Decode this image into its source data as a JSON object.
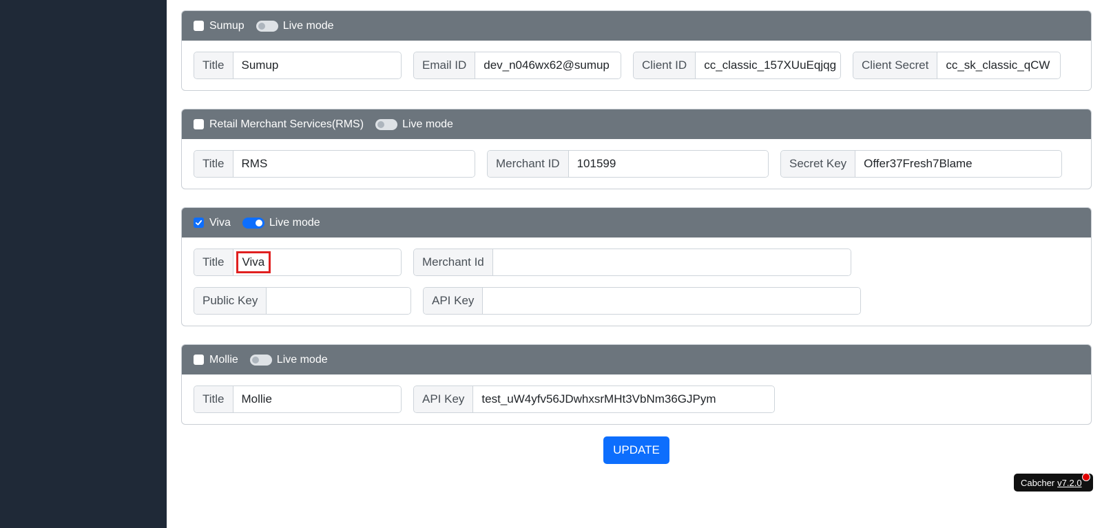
{
  "providers": [
    {
      "name": "Sumup",
      "checked": false,
      "live_mode_on": false,
      "live_mode_label": "Live mode",
      "fields": [
        {
          "label": "Title",
          "value": "Sumup"
        },
        {
          "label": "Email ID",
          "value": "dev_n046wx62@sumup"
        },
        {
          "label": "Client ID",
          "value": "cc_classic_157XUuEqjqg"
        },
        {
          "label": "Client Secret",
          "value": "cc_sk_classic_qCW"
        }
      ]
    },
    {
      "name": "Retail Merchant Services(RMS)",
      "checked": false,
      "live_mode_on": false,
      "live_mode_label": "Live mode",
      "fields": [
        {
          "label": "Title",
          "value": "RMS"
        },
        {
          "label": "Merchant ID",
          "value": "101599"
        },
        {
          "label": "Secret Key",
          "value": "Offer37Fresh7Blame"
        }
      ]
    },
    {
      "name": "Viva",
      "checked": true,
      "live_mode_on": true,
      "live_mode_label": "Live mode",
      "fields": [
        {
          "label": "Title",
          "value": "Viva"
        },
        {
          "label": "Merchant Id",
          "value": ""
        },
        {
          "label": "Public Key",
          "value": ""
        },
        {
          "label": "API Key",
          "value": ""
        }
      ]
    },
    {
      "name": "Mollie",
      "checked": false,
      "live_mode_on": false,
      "live_mode_label": "Live mode",
      "fields": [
        {
          "label": "Title",
          "value": "Mollie"
        },
        {
          "label": "API Key",
          "value": "test_uW4yfv56JDwhxsrMHt3VbNm36GJPym"
        }
      ]
    }
  ],
  "update_label": "UPDATE",
  "badge": {
    "name": "Cabcher",
    "version": "v7.2.0"
  },
  "colors": {
    "sidebar": "#1f2937",
    "header": "#6c757d",
    "primary": "#0d6efd",
    "highlight": "#e02020"
  }
}
